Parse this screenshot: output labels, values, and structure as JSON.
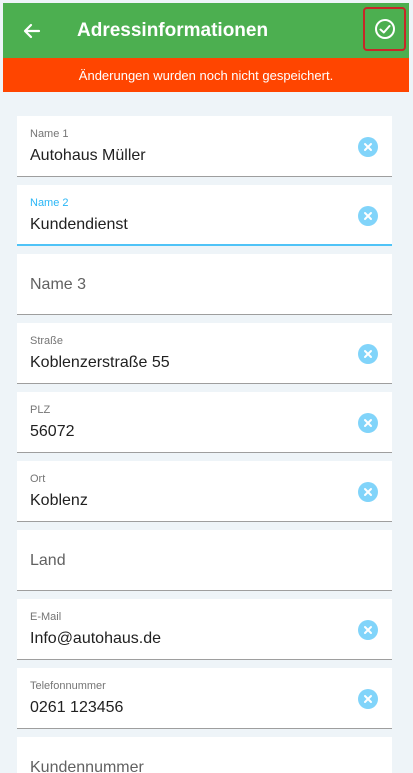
{
  "appbar": {
    "title": "Adressinformationen",
    "color": "#4caf50"
  },
  "banner": {
    "text": "Änderungen wurden noch nicht gespeichert.",
    "color": "#ff4500"
  },
  "fields": [
    {
      "label": "Name 1",
      "value": "Autohaus Müller"
    },
    {
      "label": "Name 2",
      "value": "Kundendienst"
    },
    {
      "placeholder": "Name 3"
    },
    {
      "label": "Straße",
      "value": "Koblenzerstraße 55"
    },
    {
      "label": "PLZ",
      "value": "56072"
    },
    {
      "label": "Ort",
      "value": "Koblenz"
    },
    {
      "placeholder": "Land"
    },
    {
      "label": "E-Mail",
      "value": "Info@autohaus.de"
    },
    {
      "label": "Telefonnummer",
      "value": "0261 123456"
    },
    {
      "placeholder": "Kundennummer"
    }
  ],
  "colors": {
    "accent": "#4fc3f7",
    "clear_icon": "#81d4fa"
  }
}
